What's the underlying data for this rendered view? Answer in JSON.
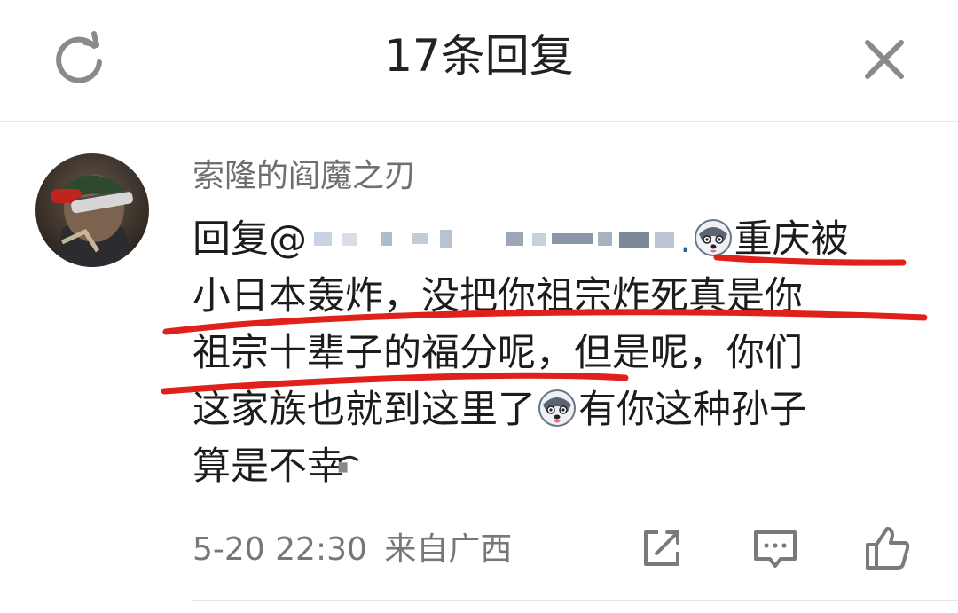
{
  "header": {
    "title": "17条回复",
    "refresh_icon": "refresh-icon",
    "close_icon": "close-icon"
  },
  "comment": {
    "username": "索隆的阎魔之刃",
    "avatar_icon": "avatar-image",
    "reply_prefix": "回复@",
    "mention_tail": ".",
    "lines": [
      "重庆被",
      "小日本轰炸，没把你祖宗炸死真是你",
      "祖宗十辈子的福分呢，但是呢，你们",
      "这家族也就到这里了",
      "有你这种孙子",
      "算是不幸"
    ],
    "emoji": "husky-dog-emoji",
    "timestamp": "5-20 22:30",
    "source": "来自广西"
  },
  "actions": {
    "share_icon": "share-icon",
    "reply_icon": "comment-icon",
    "like_icon": "thumbs-up-icon"
  },
  "colors": {
    "mention": "#2f5c9a",
    "annotation": "#e0201b",
    "meta_text": "#777777"
  }
}
